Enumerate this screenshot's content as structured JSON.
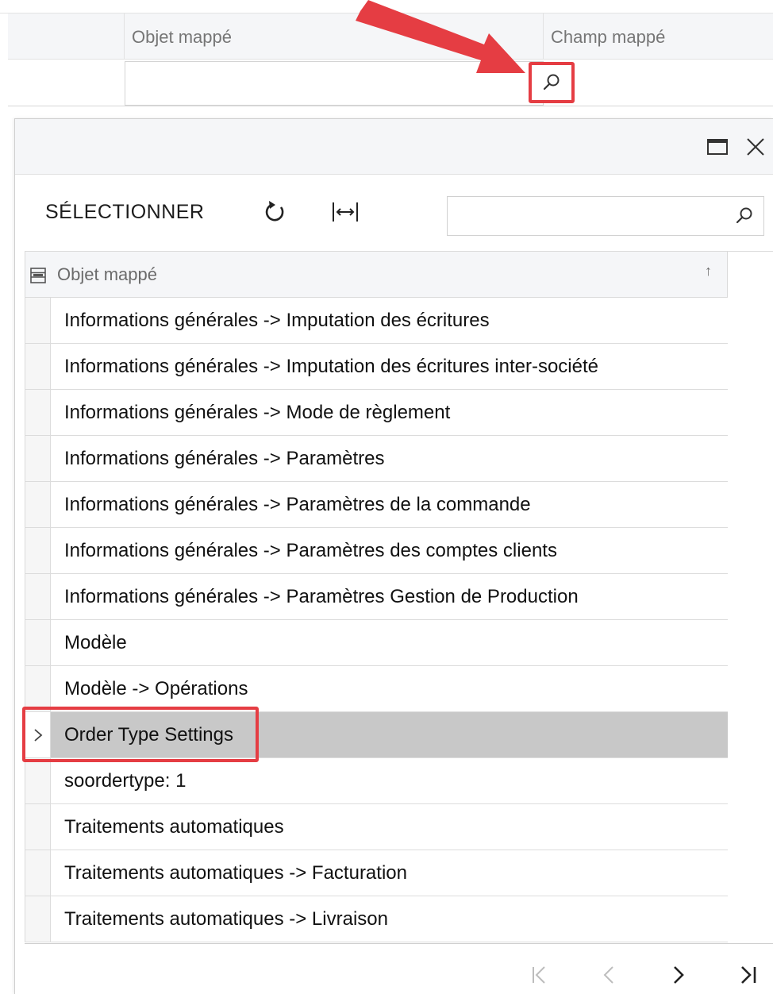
{
  "background_grid": {
    "columns": [
      {
        "label": "Objet mappé"
      },
      {
        "label": "Champ mappé"
      }
    ],
    "input_value": ""
  },
  "lookup": {
    "toolbar": {
      "select_label": "SÉLECTIONNER",
      "refresh_icon": "refresh-icon",
      "fit_columns_icon": "fit-columns-icon",
      "search_value": "",
      "search_icon": "search-icon"
    },
    "window_controls": {
      "maximize_icon": "maximize-icon",
      "close_icon": "close-icon"
    },
    "grid": {
      "column_header": "Objet mappé",
      "sort_glyph": "↑",
      "rows": [
        {
          "label": "Informations générales -> Imputation des écritures"
        },
        {
          "label": "Informations générales -> Imputation des écritures inter-société"
        },
        {
          "label": "Informations générales -> Mode de règlement"
        },
        {
          "label": "Informations générales -> Paramètres"
        },
        {
          "label": "Informations générales -> Paramètres de la commande"
        },
        {
          "label": "Informations générales -> Paramètres des comptes clients"
        },
        {
          "label": "Informations générales -> Paramètres Gestion de Production"
        },
        {
          "label": "Modèle"
        },
        {
          "label": "Modèle -> Opérations"
        },
        {
          "label": "Order Type Settings",
          "selected": true
        },
        {
          "label": "soordertype: 1"
        },
        {
          "label": "Traitements automatiques"
        },
        {
          "label": "Traitements automatiques -> Facturation"
        },
        {
          "label": "Traitements automatiques -> Livraison"
        }
      ]
    },
    "pager": {
      "first_icon": "first-page-icon",
      "prev_icon": "prev-page-icon",
      "next_icon": "next-page-icon",
      "last_icon": "last-page-icon"
    }
  },
  "colors": {
    "highlight": "#e53d43",
    "selected_row": "#c8c8c8",
    "header_bg": "#f5f6f8"
  }
}
